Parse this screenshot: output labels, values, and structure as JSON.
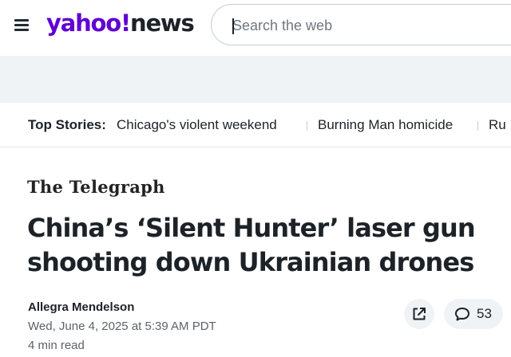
{
  "header": {
    "logo_brand": "yahoo!",
    "logo_section": "news",
    "search_placeholder": "Search the web"
  },
  "top_stories": {
    "label": "Top Stories:",
    "items": [
      "Chicago's violent weekend",
      "Burning Man homicide",
      "Ru"
    ]
  },
  "article": {
    "source": "The Telegraph",
    "headline": "China’s ‘Silent Hunter’ laser gun shooting down Ukrainian drones",
    "author": "Allegra Mendelson",
    "date": "Wed, June 4, 2025 at 5:39 AM PDT",
    "read_time": "4 min read",
    "comment_count": "53"
  },
  "icons": {
    "menu": "hamburger-menu-icon",
    "share": "share-icon",
    "comments": "comment-icon"
  },
  "colors": {
    "brand_purple": "#6001d2",
    "text_dark": "#1d2228",
    "band_grey": "#f0f3f5"
  }
}
